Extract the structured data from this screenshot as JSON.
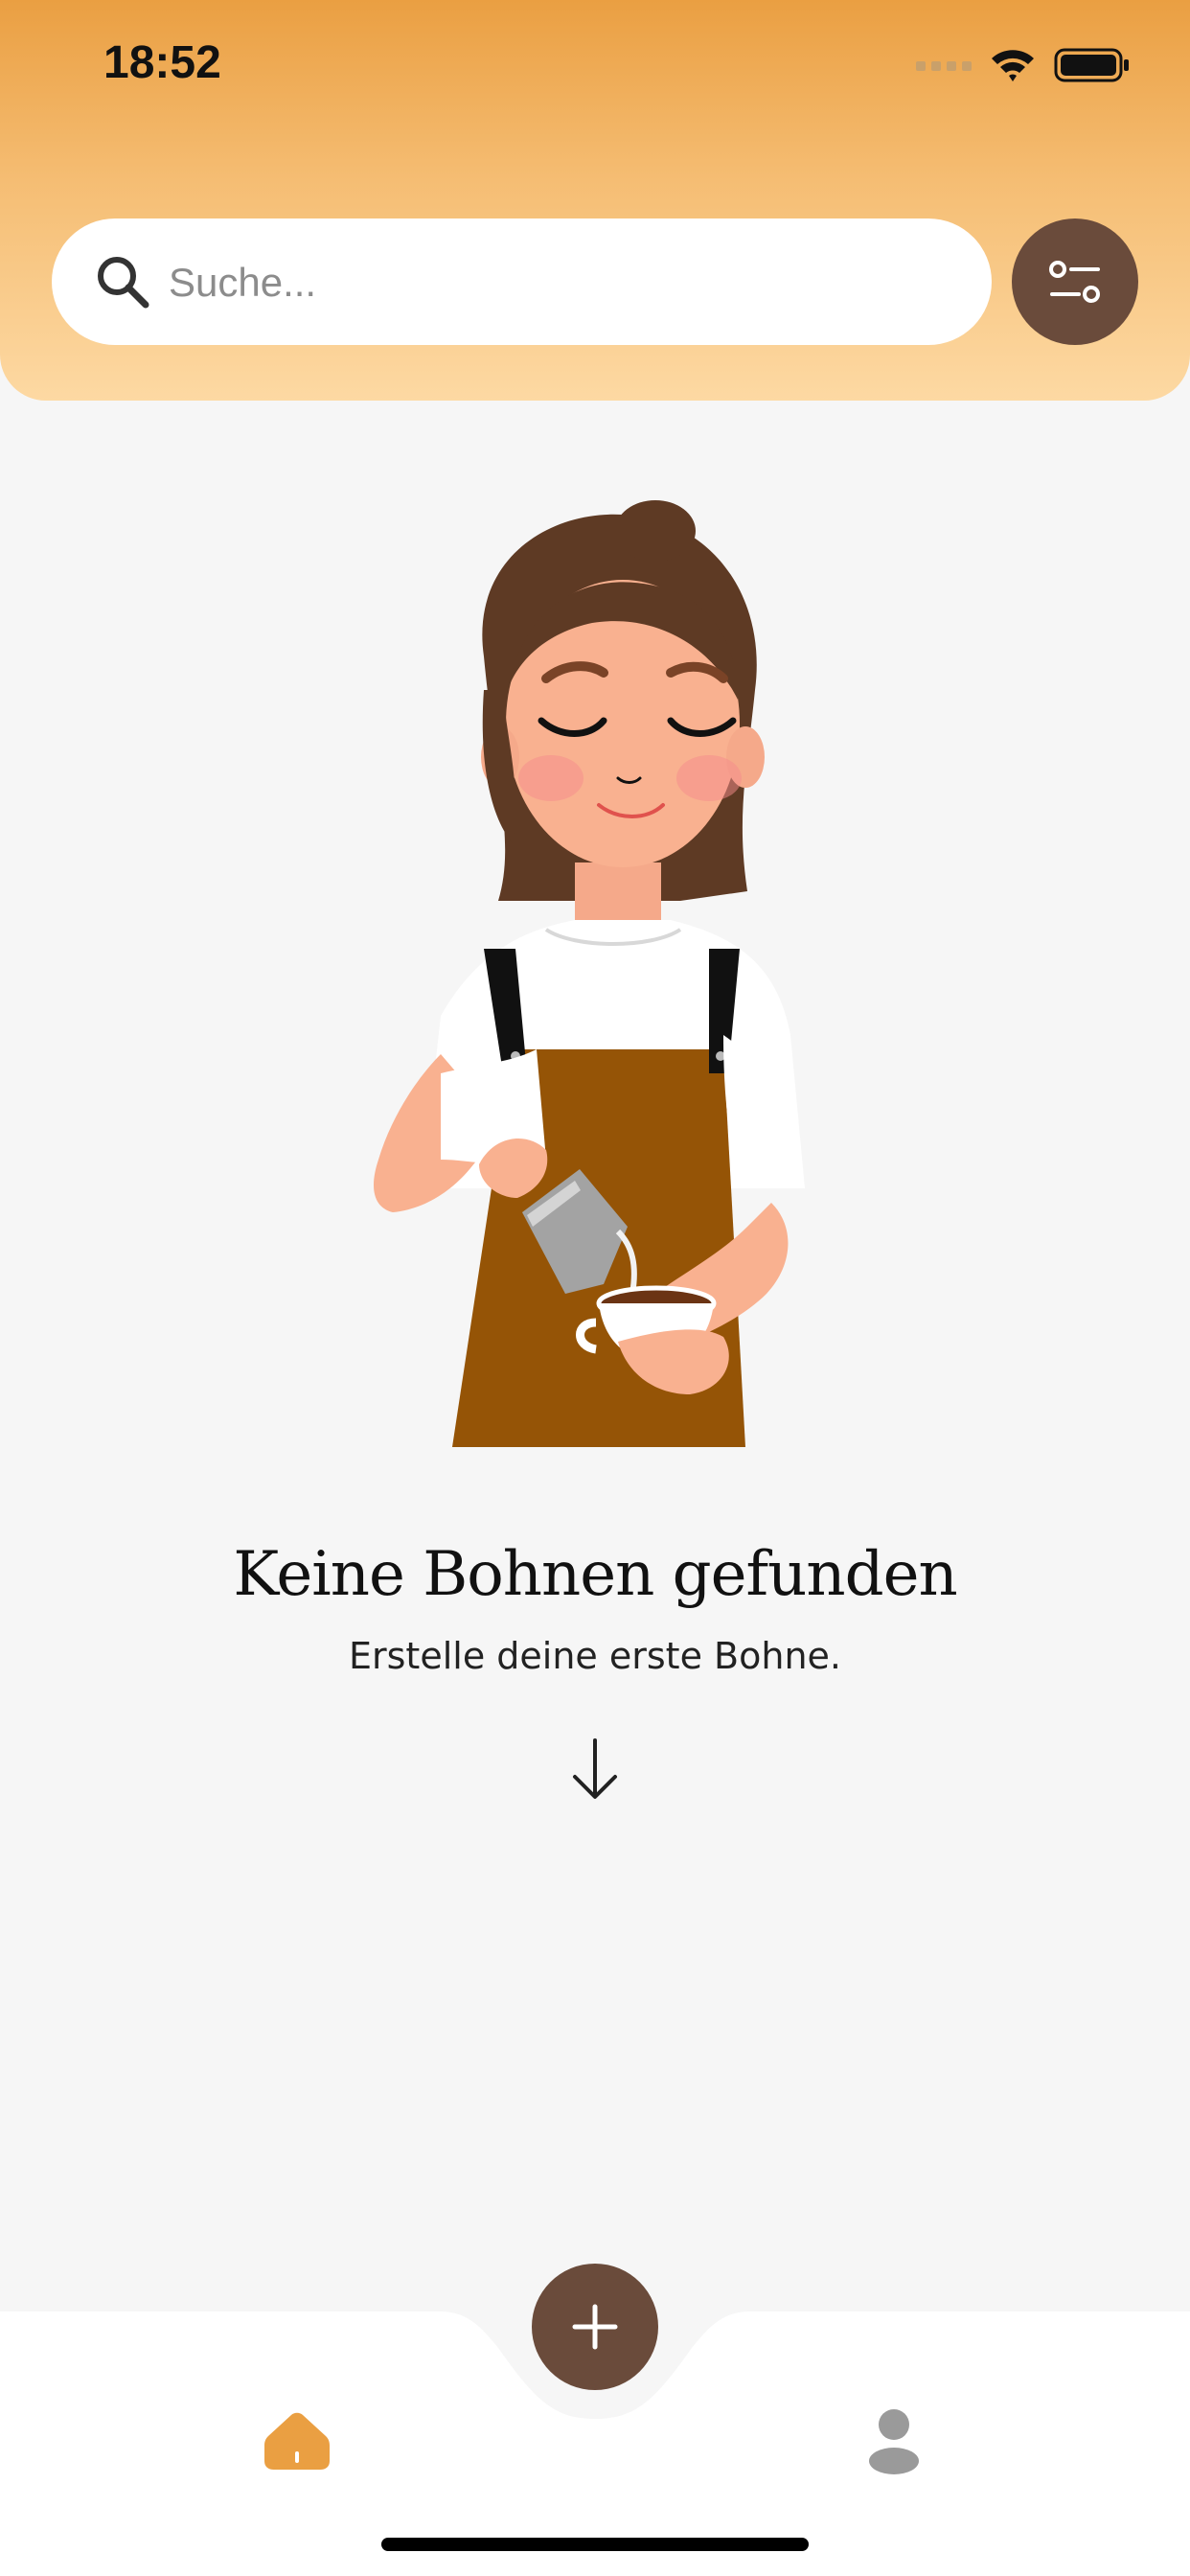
{
  "status_bar": {
    "time": "18:52"
  },
  "search": {
    "placeholder": "Suche...",
    "value": ""
  },
  "empty_state": {
    "title": "Keine Bohnen gefunden",
    "subtitle": "Erstelle deine erste Bohne."
  },
  "icons": {
    "search": "search-icon",
    "filter": "sliders-icon",
    "arrow": "arrow-down-icon",
    "add": "plus-icon",
    "home": "home-icon",
    "profile": "person-icon"
  },
  "colors": {
    "header_top": "#ea9f42",
    "header_bottom": "#fdd9a3",
    "accent_brown": "#6a4b3b",
    "active_tab": "#ea9f42",
    "inactive_tab": "#9a9a9a",
    "background": "#f6f6f6"
  }
}
